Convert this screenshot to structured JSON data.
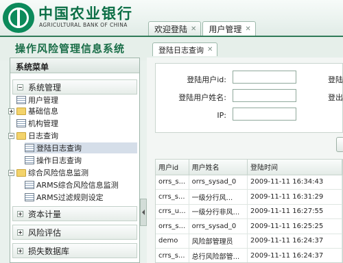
{
  "header": {
    "bank_name": "中国农业银行",
    "bank_name_en": "AGRICULTURAL BANK OF CHINA",
    "tabs": [
      {
        "label": "欢迎登陆"
      },
      {
        "label": "用户管理"
      }
    ]
  },
  "system_title": "操作风险管理信息系统",
  "content_tab": {
    "label": "登陆日志查询"
  },
  "sidebar": {
    "title": "系统菜单",
    "sections": [
      {
        "label": "系统管理"
      },
      {
        "label": "资本计量"
      },
      {
        "label": "风险评估"
      },
      {
        "label": "损失数据库"
      }
    ],
    "tree": [
      {
        "label": "用户管理"
      },
      {
        "label": "基础信息"
      },
      {
        "label": "机构管理"
      },
      {
        "label": "日志查询"
      },
      {
        "label": "登陆日志查询"
      },
      {
        "label": "操作日志查询"
      },
      {
        "label": "综合风险信息监测"
      },
      {
        "label": "ARMS综合风险信息监测"
      },
      {
        "label": "ARMS过滤规则设定"
      }
    ]
  },
  "form": {
    "user_id_label": "登陆用户id:",
    "user_name_label": "登陆用户姓名:",
    "ip_label": "IP:",
    "right_label_1": "登陆",
    "right_label_2": "登出"
  },
  "table": {
    "columns": [
      "用户id",
      "用户姓名",
      "登陆时间"
    ],
    "rows": [
      [
        "orrs_s...",
        "orrs_sysad_0",
        "2009-11-11 16:34:43"
      ],
      [
        "crrs_s...",
        "一级分行风...",
        "2009-11-11 16:31:29"
      ],
      [
        "crrs_u...",
        "一级分行非风...",
        "2009-11-11 16:27:55"
      ],
      [
        "orrs_s...",
        "orrs_sysad_0",
        "2009-11-11 16:25:25"
      ],
      [
        "demo",
        "风险部管理员",
        "2009-11-11 16:24:37"
      ],
      [
        "crrs_s...",
        "总行风险部管...",
        "2009-11-11 16:24:37"
      ]
    ]
  },
  "colors": {
    "brand_green": "#0b6e45",
    "accent": "#2f7a57"
  }
}
